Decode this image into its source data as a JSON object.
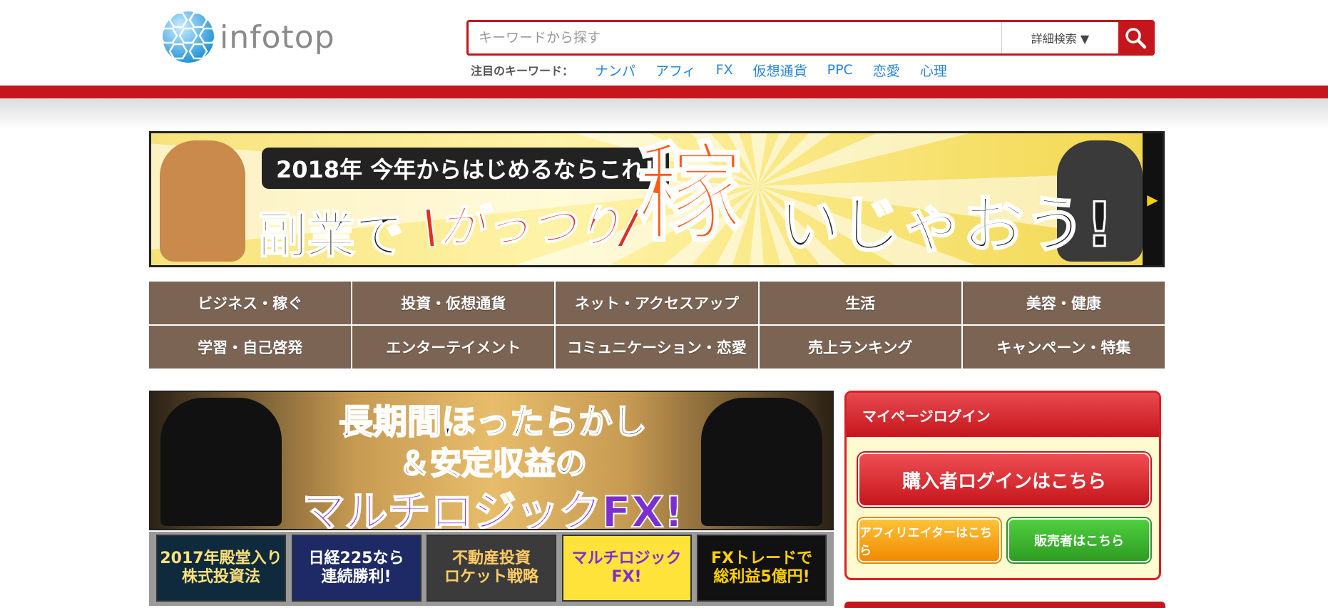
{
  "header": {
    "logo_text": "infotop",
    "search": {
      "placeholder": "キーワードから探す",
      "value": "",
      "advanced_label": "詳細検索 ▼"
    },
    "keywords_label": "注目のキーワード：",
    "keywords": [
      "ナンパ",
      "アフィ",
      "FX",
      "仮想通貨",
      "PPC",
      "恋愛",
      "心理"
    ]
  },
  "banner": {
    "subtitle": "2018年 今年からはじめるならこれ!",
    "line1": "副業で",
    "line2": "\\がっつり/",
    "line3": "稼",
    "line4": "いじゃおう!"
  },
  "categories": [
    "ビジネス・稼ぐ",
    "投資・仮想通貨",
    "ネット・アクセスアップ",
    "生活",
    "美容・健康",
    "学習・自己啓発",
    "エンターテイメント",
    "コミュニケーション・恋愛",
    "売上ランキング",
    "キャンペーン・特集"
  ],
  "promo": {
    "line1": "長期間ほったらかし",
    "line2": "＆安定収益の",
    "line3": "マルチロジックFX!"
  },
  "thumbs": [
    "2017年殿堂入り\n株式投資法",
    "日経225なら\n連続勝利!",
    "不動産投資\nロケット戦略",
    "マルチロジック\nFX!",
    "FXトレードで\n総利益5億円!"
  ],
  "login": {
    "title": "マイページログイン",
    "buyer_label": "購入者ログインはこちら",
    "affiliate_label": "アフィリエイターはこちら",
    "seller_label": "販売者はこちら"
  },
  "colors": {
    "brand_red": "#c4161c",
    "category_brown": "#7b6454",
    "keyword_blue": "#2a86d6"
  }
}
